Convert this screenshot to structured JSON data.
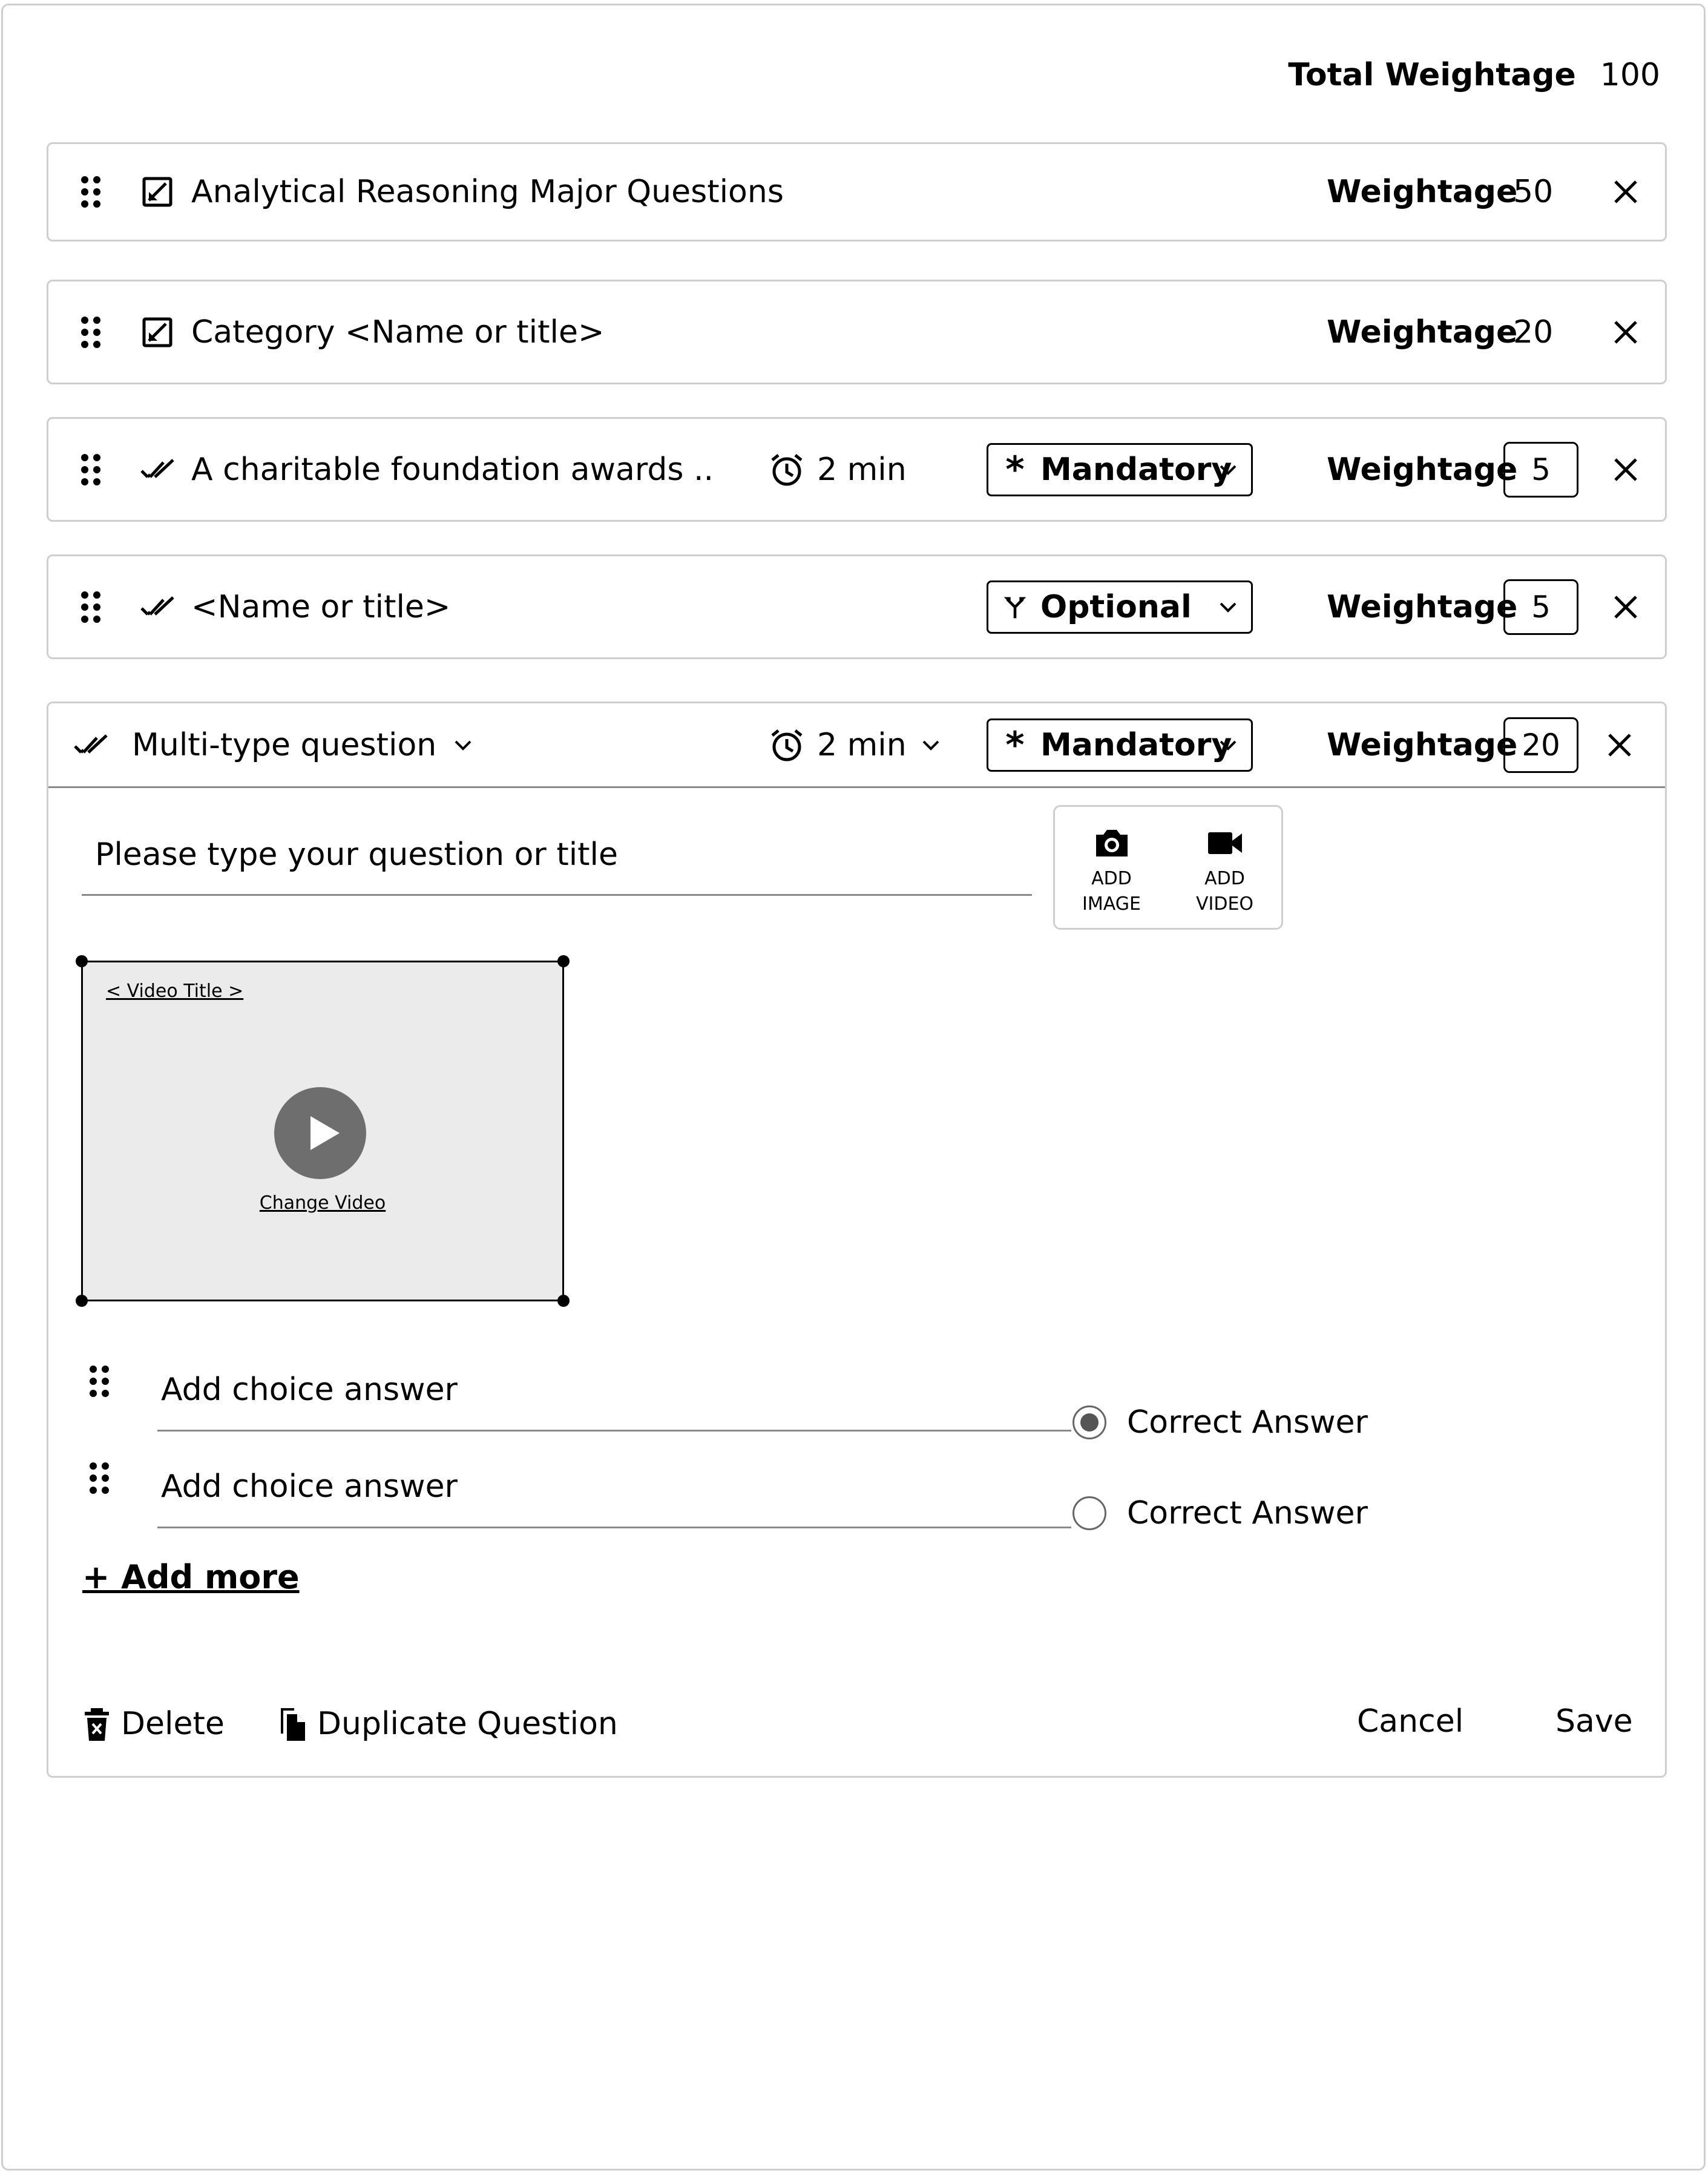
{
  "total": {
    "label": "Total Weightage",
    "value": "100"
  },
  "weightage_label": "Weightage",
  "rows": [
    {
      "title": "Analytical Reasoning Major Questions",
      "weight": "50"
    },
    {
      "title": "Category <Name or title>",
      "weight": "20"
    },
    {
      "title": "A charitable foundation awards ..",
      "time": "2 min",
      "requirement": "Mandatory",
      "weight": "5"
    },
    {
      "title": "<Name or title>",
      "requirement": "Optional",
      "weight": "5"
    }
  ],
  "expanded": {
    "type": "Multi-type question",
    "time": "2 min",
    "requirement": "Mandatory",
    "weight": "20",
    "question_placeholder": "Please type your question or title",
    "media": {
      "add_image": "ADD\nIMAGE",
      "add_video": "ADD\nVIDEO"
    },
    "video": {
      "title": "< Video Title >",
      "change": "Change Video"
    },
    "choices": [
      {
        "text": "Add choice answer",
        "correct_label": "Correct Answer",
        "selected": true
      },
      {
        "text": "Add choice answer",
        "correct_label": "Correct Answer",
        "selected": false
      }
    ],
    "add_more": "+ Add more",
    "footer": {
      "delete": "Delete",
      "duplicate": "Duplicate Question",
      "cancel": "Cancel",
      "save": "Save"
    }
  }
}
